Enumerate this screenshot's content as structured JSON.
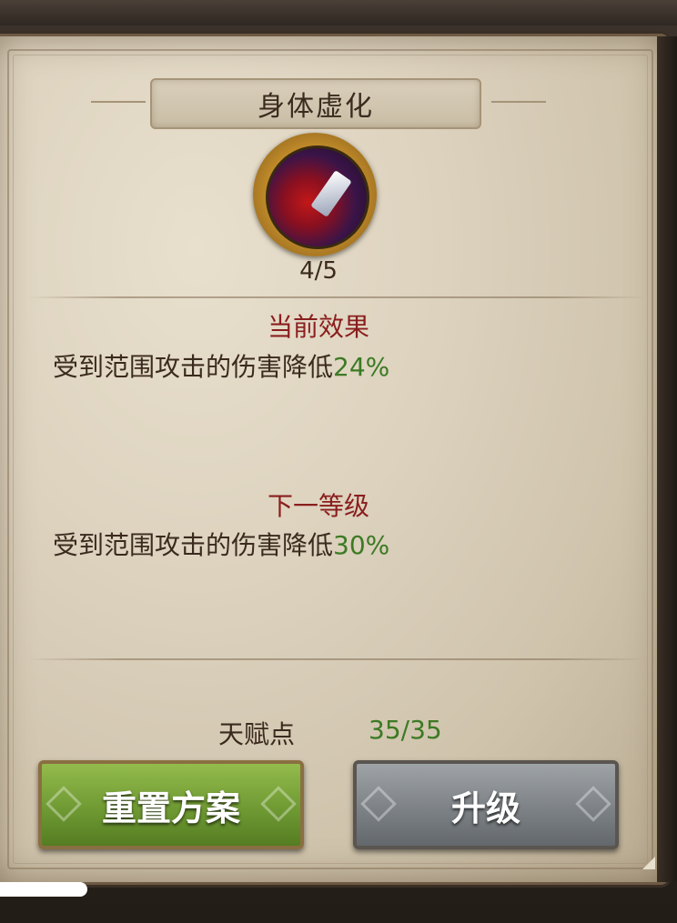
{
  "dialog": {
    "title": "身体虚化",
    "skill_icon": "skill-blood-crystal-icon",
    "level": "4/5"
  },
  "current_effect": {
    "heading": "当前效果",
    "text": "受到范围攻击的伤害降低",
    "value": "24%"
  },
  "next_level": {
    "heading": "下一等级",
    "text": "受到范围攻击的伤害降低",
    "value": "30%"
  },
  "talent_points": {
    "label": "天赋点",
    "value": "35/35"
  },
  "buttons": {
    "reset_label": "重置方案",
    "upgrade_label": "升级"
  },
  "colors": {
    "heading_red": "#8a1e1e",
    "value_green": "#3c7a24",
    "reset_button_green": "#6f9a33",
    "upgrade_button_gray": "#7d8286"
  }
}
